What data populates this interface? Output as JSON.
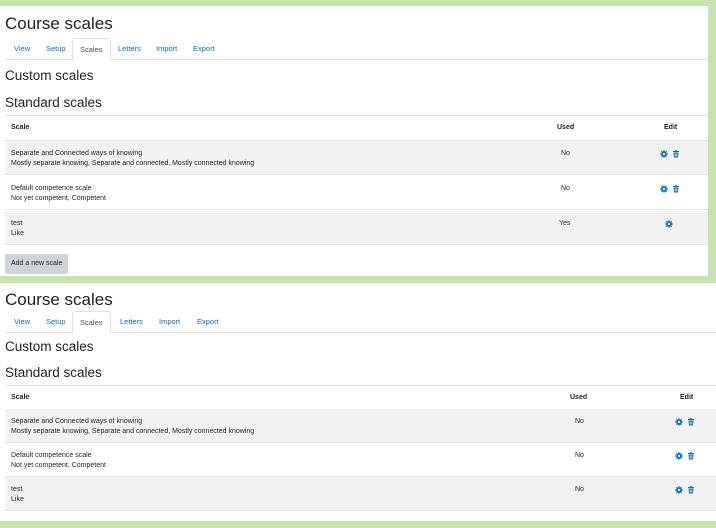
{
  "panels": [
    {
      "title": "Course scales",
      "tabs": [
        "View",
        "Setup",
        "Scales",
        "Letters",
        "Import",
        "Export"
      ],
      "active_tab": "Scales",
      "custom_heading": "Custom scales",
      "standard_heading": "Standard scales",
      "columns": {
        "scale": "Scale",
        "used": "Used",
        "edit": "Edit"
      },
      "rows": [
        {
          "name": "Separate and Connected ways of knowing",
          "items": "Mostly separate knowing, Separate and connected, Mostly connected knowing",
          "used": "No",
          "actions": [
            "gear-icon",
            "trash-icon"
          ]
        },
        {
          "name": "Default competence scale",
          "items": "Not yet competent, Competent",
          "used": "No",
          "actions": [
            "gear-icon",
            "trash-icon"
          ]
        },
        {
          "name": "test",
          "items": "Like",
          "used": "Yes",
          "actions": [
            "gear-icon"
          ]
        }
      ],
      "add_button": "Add a new scale"
    },
    {
      "title": "Course scales",
      "tabs": [
        "View",
        "Setup",
        "Scales",
        "Letters",
        "Import",
        "Export"
      ],
      "active_tab": "Scales",
      "custom_heading": "Custom scales",
      "standard_heading": "Standard scales",
      "columns": {
        "scale": "Scale",
        "used": "Used",
        "edit": "Edit"
      },
      "rows": [
        {
          "name": "Separate and Connected ways of knowing",
          "items": "Mostly separate knowing, Separate and connected, Mostly connected knowing",
          "used": "No",
          "actions": [
            "gear-icon",
            "trash-icon"
          ]
        },
        {
          "name": "Default competence scale",
          "items": "Not yet competent, Competent",
          "used": "No",
          "actions": [
            "gear-icon",
            "trash-icon"
          ]
        },
        {
          "name": "test",
          "items": "Like",
          "used": "No",
          "actions": [
            "gear-icon",
            "trash-icon"
          ]
        }
      ]
    }
  ],
  "colors": {
    "link": "#0f6cbf",
    "accent_icon": "#0f6cbf",
    "stripe": "#f2f2f2",
    "button": "#ced4da"
  }
}
